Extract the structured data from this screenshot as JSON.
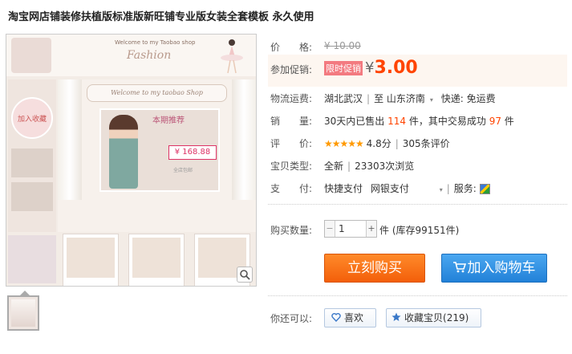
{
  "product": {
    "title": "淘宝网店铺装修扶植版标准版新旺铺专业版女装全套模板 永久使用"
  },
  "gallery": {
    "banner_text": "Welcome to my Taobao shop",
    "banner_script": "Fashion",
    "badge_text": "加入收藏",
    "welcome_text": "Welcome to my taobao Shop",
    "feature_tag": "本期推荐",
    "feature_price": "¥ 168.88",
    "feature_small": "全店包邮"
  },
  "info": {
    "price_label": "价　　格:",
    "price_value": "¥ 10.00",
    "promo_label": "参加促销:",
    "promo_tag": "限时促销",
    "promo_yen": "¥",
    "promo_price": "3.00",
    "shipping_label": "物流运费:",
    "shipping_from": "湖北武汉",
    "shipping_to_prefix": "至",
    "shipping_to": "山东济南",
    "shipping_fee": "快递: 免运费",
    "sales_label": "销　　量:",
    "sales_prefix": "30天内已售出",
    "sales_count": "114",
    "sales_mid": "件，其中交易成功",
    "sales_success": "97",
    "sales_suffix": "件",
    "rating_label": "评　　价:",
    "rating_stars": "★★★★★",
    "rating_score": "4.8分",
    "rating_reviews": "305条评价",
    "type_label": "宝贝类型:",
    "type_value": "全新",
    "views": "23303次浏览",
    "pay_label": "支　　付:",
    "pay_quick": "快捷支付",
    "pay_bank": "网银支付",
    "service_label": "服务:",
    "qty_label": "购买数量:",
    "qty_value": "1",
    "qty_unit": "件 (库存99151件)",
    "buy_label": "立刻购买",
    "cart_label": "加入购物车",
    "share_label": "你还可以:",
    "like_label": "喜欢",
    "fav_label": "收藏宝贝",
    "fav_count": "(219)"
  }
}
